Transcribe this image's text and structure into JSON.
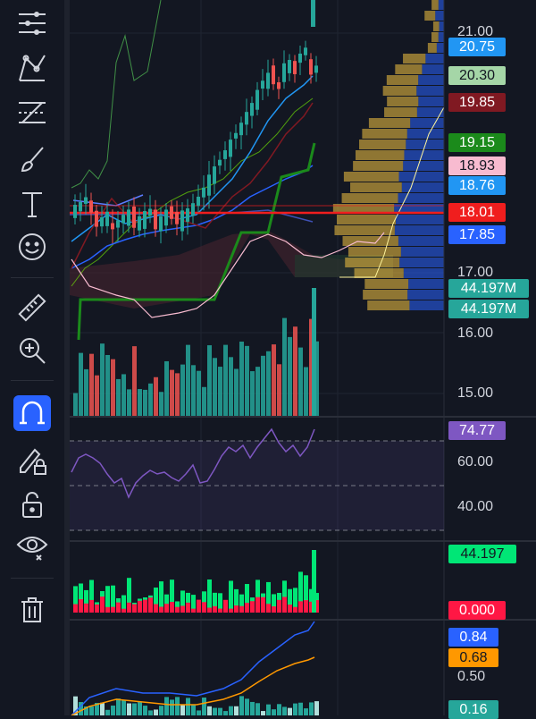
{
  "toolbar": {
    "tools": [
      {
        "name": "crosshair-lines-icon"
      },
      {
        "name": "trend-pattern-icon"
      },
      {
        "name": "fib-retracement-icon"
      },
      {
        "name": "brush-icon"
      },
      {
        "name": "text-tool-icon"
      },
      {
        "name": "emoji-icon"
      },
      {
        "name": "ruler-icon"
      },
      {
        "name": "zoom-in-icon"
      },
      {
        "name": "magnet-icon"
      },
      {
        "name": "lock-drawing-icon"
      },
      {
        "name": "unlock-icon"
      },
      {
        "name": "eye-icon"
      },
      {
        "name": "trash-icon"
      }
    ]
  },
  "colors": {
    "background": "#131722",
    "accent": "#2962ff",
    "up": "#26a69a",
    "down": "#ef5350",
    "volume_up": "#26a69a",
    "volume_down": "#ef5350",
    "rsi": "#7e57c2",
    "macd_up": "#00e676",
    "macd_down": "#ff1744"
  },
  "price_axis": {
    "ticks": [
      "21.00",
      "17.00",
      "16.00",
      "15.00"
    ]
  },
  "price_badges": [
    {
      "value": "20.75",
      "bg": "#2196f3",
      "fg": "#ffffff"
    },
    {
      "value": "20.30",
      "bg": "#a5d6a7",
      "fg": "#131722"
    },
    {
      "value": "19.85",
      "bg": "#801922",
      "fg": "#ffffff"
    },
    {
      "value": "19.15",
      "bg": "#1b8a1b",
      "fg": "#ffffff"
    },
    {
      "value": "18.93",
      "bg": "#f8bbd0",
      "fg": "#131722"
    },
    {
      "value": "18.76",
      "bg": "#2196f3",
      "fg": "#ffffff"
    },
    {
      "value": "18.01",
      "bg": "#f01e1e",
      "fg": "#ffffff"
    },
    {
      "value": "17.85",
      "bg": "#2962ff",
      "fg": "#ffffff"
    },
    {
      "value": "44.197M",
      "bg": "#26a69a",
      "fg": "#ffffff"
    },
    {
      "value": "44.197M",
      "bg": "#26a69a",
      "fg": "#ffffff"
    }
  ],
  "rsi_pane": {
    "badge": "74.77",
    "ticks": [
      "60.00",
      "40.00"
    ]
  },
  "volume_pane": {
    "badge_top": "44.197",
    "badge_bottom": "0.000"
  },
  "macd_pane": {
    "badge_1": "0.84",
    "badge_2": "0.68",
    "tick": "0.50",
    "badge_3": "0.16"
  }
}
